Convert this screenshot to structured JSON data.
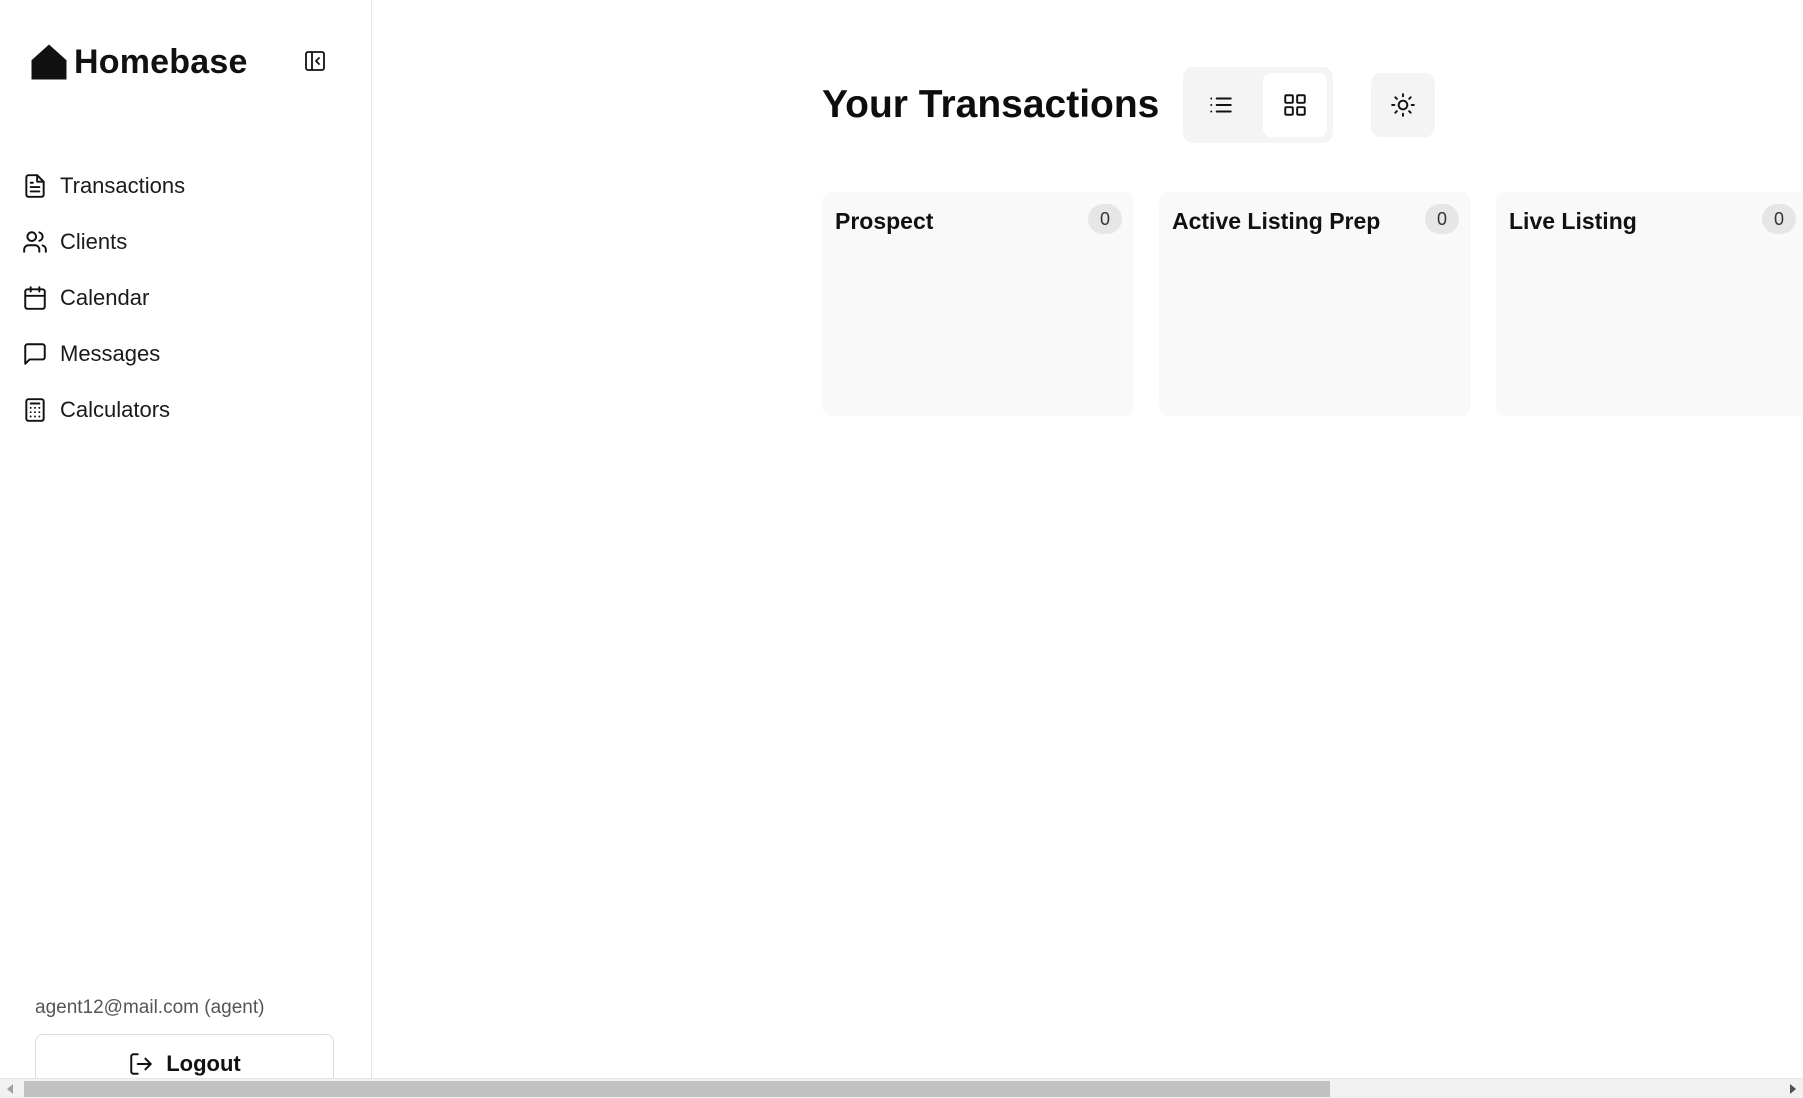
{
  "brand": {
    "name": "Homebase",
    "icon": "house-icon"
  },
  "sidebar": {
    "collapse_icon": "sidebar-collapse-icon",
    "items": [
      {
        "label": "Transactions",
        "icon": "document-icon"
      },
      {
        "label": "Clients",
        "icon": "users-icon"
      },
      {
        "label": "Calendar",
        "icon": "calendar-icon"
      },
      {
        "label": "Messages",
        "icon": "message-icon"
      },
      {
        "label": "Calculators",
        "icon": "calculator-icon"
      }
    ],
    "user_email": "agent12@mail.com (agent)",
    "logout_label": "Logout"
  },
  "main": {
    "title": "Your Transactions",
    "view_toggle": {
      "list_icon": "list-icon",
      "grid_icon": "grid-icon",
      "active": "grid"
    },
    "theme_icon": "sun-icon",
    "columns": [
      {
        "title": "Prospect",
        "count": "0"
      },
      {
        "title": "Active Listing Prep",
        "count": "0"
      },
      {
        "title": "Live Listing",
        "count": "0"
      }
    ]
  },
  "scrollbar": {
    "position_fraction": 0.0,
    "visible_fraction": 0.74
  }
}
